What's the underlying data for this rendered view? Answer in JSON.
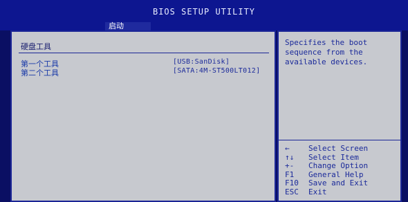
{
  "header": {
    "title": "BIOS SETUP UTILITY"
  },
  "tabs": [
    {
      "label": "启动"
    }
  ],
  "main": {
    "section_title": "硬盘工具",
    "rows": [
      {
        "label": "第一个工具",
        "value": "[USB:SanDisk]"
      },
      {
        "label": "第二个工具",
        "value": "[SATA:4M-ST500LT012]"
      }
    ]
  },
  "help": {
    "text": "Specifies the boot\nsequence from the\navailable devices.",
    "keys": [
      {
        "key": "←",
        "desc": "Select Screen"
      },
      {
        "key": "↑↓",
        "desc": "Select Item"
      },
      {
        "key": "+-",
        "desc": "Change Option"
      },
      {
        "key": "F1",
        "desc": "General Help"
      },
      {
        "key": "F10",
        "desc": "Save and Exit"
      },
      {
        "key": "ESC",
        "desc": "Exit"
      }
    ]
  },
  "colors": {
    "background": "#0a0f63",
    "panel": "#c7c9cf",
    "text": "#1b2a9a"
  }
}
